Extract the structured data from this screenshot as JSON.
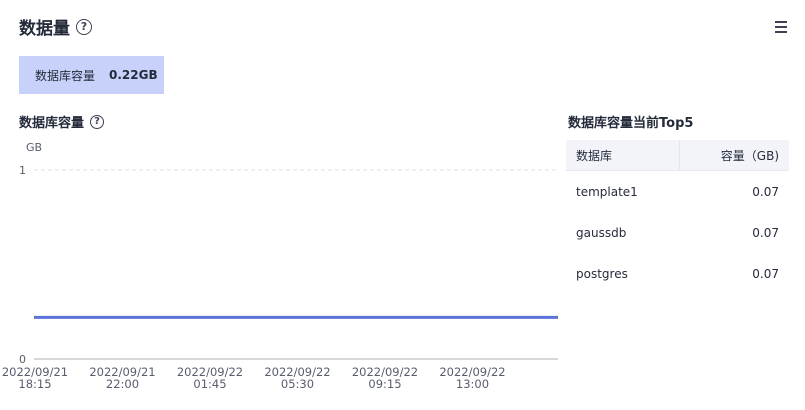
{
  "header": {
    "title": "数据量",
    "help_icon": "?"
  },
  "summary": {
    "label": "数据库容量",
    "value": "0.22GB",
    "color": "#c7d1fa"
  },
  "section": {
    "title": "数据库容量",
    "help_icon": "?"
  },
  "chart_data": {
    "type": "line",
    "title": "",
    "ylabel": "GB",
    "ylim": [
      0,
      1
    ],
    "yticks": [
      "1",
      "0"
    ],
    "xticks": [
      {
        "date": "2022/09/21",
        "time": "18:15"
      },
      {
        "date": "2022/09/21",
        "time": "22:00"
      },
      {
        "date": "2022/09/22",
        "time": "01:45"
      },
      {
        "date": "2022/09/22",
        "time": "05:30"
      },
      {
        "date": "2022/09/22",
        "time": "09:15"
      },
      {
        "date": "2022/09/22",
        "time": "13:00"
      }
    ],
    "x": [
      "2022/09/21 18:15",
      "2022/09/22 16:45"
    ],
    "series": [
      {
        "values": [
          0.22,
          0.22
        ],
        "color": "#5b73d9"
      }
    ],
    "grid": true
  },
  "top5": {
    "title": "数据库容量当前Top5",
    "columns": [
      "数据库",
      "容量（GB)"
    ],
    "rows": [
      {
        "name": "template1",
        "value": "0.07"
      },
      {
        "name": "gaussdb",
        "value": "0.07"
      },
      {
        "name": "postgres",
        "value": "0.07"
      }
    ]
  }
}
